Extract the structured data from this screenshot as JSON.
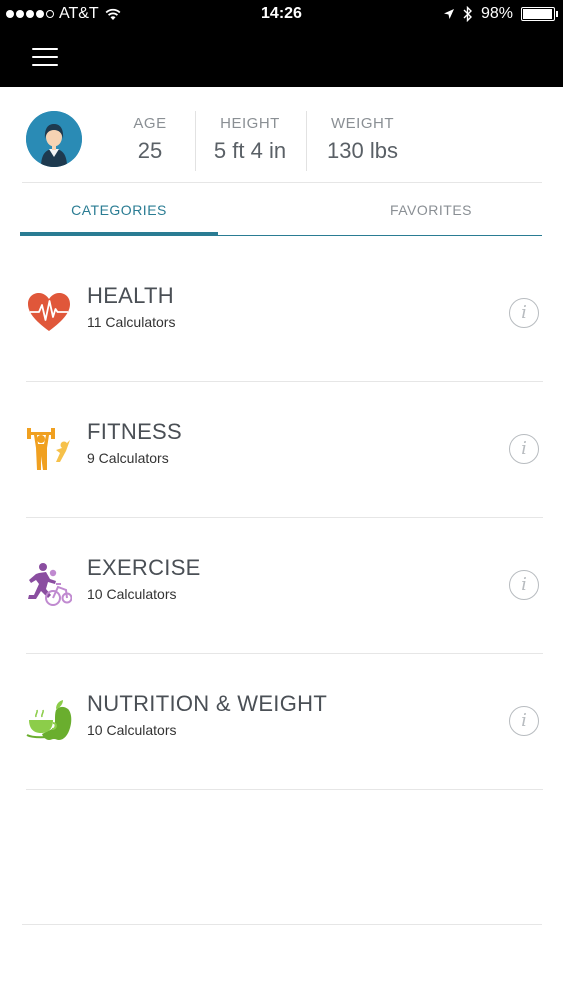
{
  "status_bar": {
    "carrier": "AT&T",
    "time": "14:26",
    "battery": "98%",
    "battery_level": 0.98,
    "signal_bars": 4,
    "icons": [
      "signal-dots-icon",
      "wifi-icon",
      "location-arrow-icon",
      "bluetooth-icon",
      "battery-icon"
    ]
  },
  "nav": {
    "menu_icon": "hamburger-menu-icon"
  },
  "profile": {
    "avatar_icon": "female-user-avatar-icon",
    "stats": [
      {
        "label": "AGE",
        "value": "25"
      },
      {
        "label": "HEIGHT",
        "value": "5 ft 4 in"
      },
      {
        "label": "WEIGHT",
        "value": "130 lbs"
      }
    ]
  },
  "tabs": [
    {
      "label": "CATEGORIES",
      "active": true
    },
    {
      "label": "FAVORITES",
      "active": false
    }
  ],
  "categories": [
    {
      "title": "HEALTH",
      "subtitle": "11 Calculators",
      "icon": "heart-pulse-icon",
      "info_label": "i"
    },
    {
      "title": "FITNESS",
      "subtitle": "9 Calculators",
      "icon": "weightlifting-icon",
      "info_label": "i"
    },
    {
      "title": "EXERCISE",
      "subtitle": "10 Calculators",
      "icon": "running-cycling-icon",
      "info_label": "i"
    },
    {
      "title": "NUTRITION & WEIGHT",
      "subtitle": "10 Calculators",
      "icon": "apple-cup-icon",
      "info_label": "i"
    }
  ],
  "colors": {
    "accent": "#2a7c93",
    "health": "#e0573a",
    "fitness": "#f0a020",
    "exercise": "#8a4ea0",
    "nutrition": "#6aae2e",
    "avatar_bg": "#2a8bb5"
  }
}
